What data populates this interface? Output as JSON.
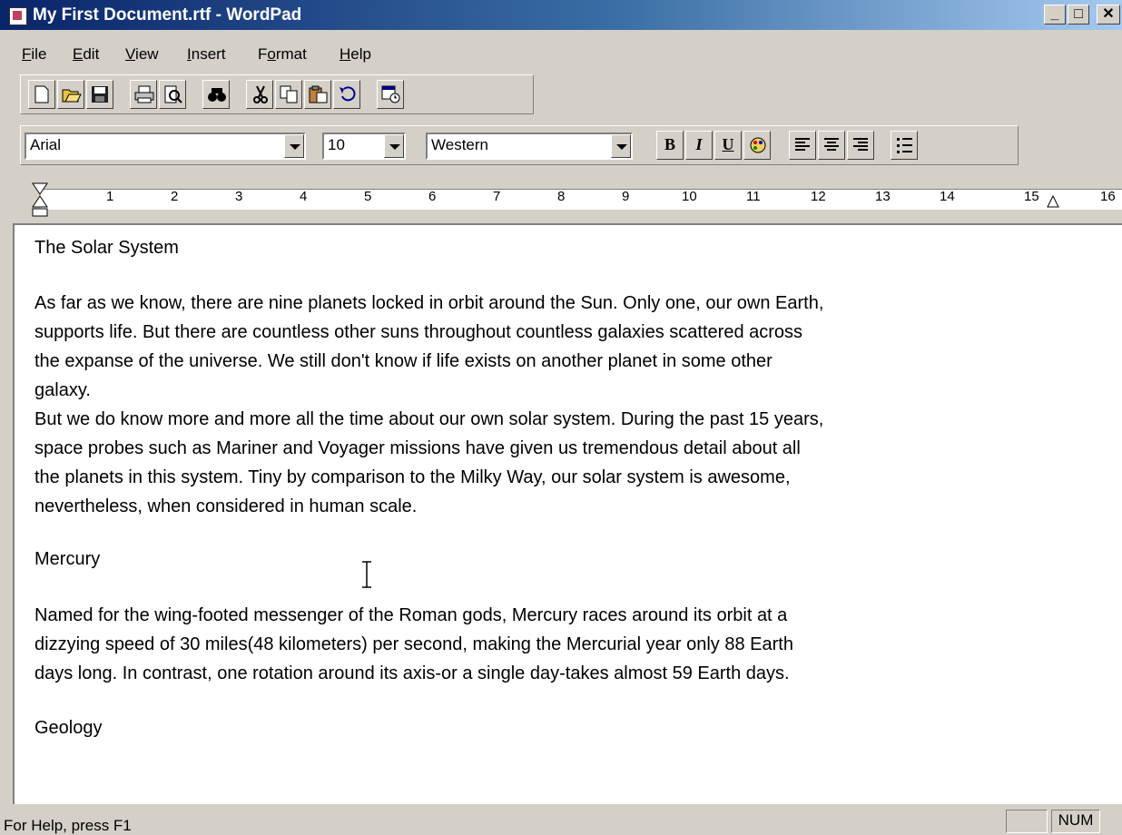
{
  "window": {
    "title": "My First Document.rtf - WordPad",
    "minimize": "_",
    "maximize": "□",
    "close": "✕"
  },
  "menu": [
    {
      "label": "File",
      "u": "F",
      "rest": "ile"
    },
    {
      "label": "Edit",
      "u": "E",
      "rest": "dit"
    },
    {
      "label": "View",
      "u": "V",
      "rest": "iew"
    },
    {
      "label": "Insert",
      "u": "I",
      "rest": "nsert"
    },
    {
      "label": "Format",
      "u": "o",
      "pre": "F",
      "rest": "rmat"
    },
    {
      "label": "Help",
      "u": "H",
      "rest": "elp"
    }
  ],
  "toolbar": {
    "buttons": [
      "new-icon",
      "open-icon",
      "save-icon",
      "print-icon",
      "print-preview-icon",
      "find-icon",
      "cut-icon",
      "copy-icon",
      "paste-icon",
      "undo-icon",
      "insert-datetime-icon"
    ]
  },
  "format": {
    "font": "Arial",
    "size": "10",
    "script": "Western",
    "bold": "B",
    "italic": "I",
    "underline": "U"
  },
  "ruler": {
    "labels": [
      "1",
      "2",
      "3",
      "4",
      "5",
      "6",
      "7",
      "8",
      "9",
      "10",
      "11",
      "12",
      "13",
      "14",
      "15",
      "16"
    ]
  },
  "document": {
    "heading": "The Solar System",
    "p1": [
      "As far as we know, there are nine planets locked in orbit around the Sun. Only one, our own Earth,",
      "supports life. But there are countless other suns throughout countless galaxies scattered across",
      "the expanse of the universe. We still don't know if life exists on another planet in some other",
      "galaxy.",
      "But we do know more and more all the time about our own solar system. During the past 15 years,",
      "space probes such as Mariner and Voyager missions have given us tremendous detail about all",
      "the planets in this system. Tiny by comparison to the Milky Way, our solar system is awesome,",
      "nevertheless, when considered in human scale."
    ],
    "sub1": "Mercury",
    "p2": [
      "Named for the wing-footed messenger of the Roman gods, Mercury races around its orbit at a",
      "dizzying speed of 30 miles(48 kilometers) per second, making the Mercurial year only 88 Earth",
      "days long. In contrast, one rotation around its axis-or a single day-takes almost 59 Earth days."
    ],
    "sub2": "Geology"
  },
  "status": {
    "help": "For Help, press F1",
    "num": "NUM"
  }
}
